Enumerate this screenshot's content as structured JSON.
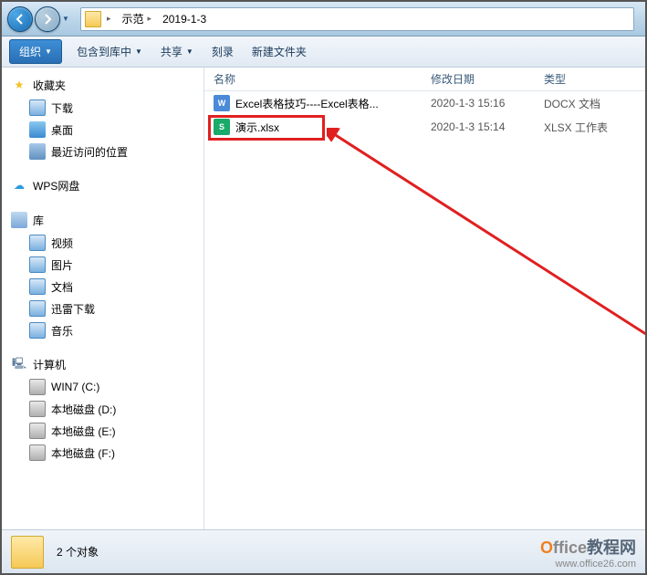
{
  "breadcrumb": {
    "seg1": "示范",
    "seg2": "2019-1-3"
  },
  "toolbar": {
    "organize": "组织",
    "include": "包含到库中",
    "share": "共享",
    "burn": "刻录",
    "newfolder": "新建文件夹"
  },
  "sidebar": {
    "favorites": "收藏夹",
    "downloads": "下载",
    "desktop": "桌面",
    "recent": "最近访问的位置",
    "wps": "WPS网盘",
    "libraries": "库",
    "videos": "视频",
    "pictures": "图片",
    "documents": "文档",
    "xunlei": "迅雷下载",
    "music": "音乐",
    "computer": "计算机",
    "drive_c": "WIN7 (C:)",
    "drive_d": "本地磁盘 (D:)",
    "drive_e": "本地磁盘 (E:)",
    "drive_f": "本地磁盘 (F:)"
  },
  "columns": {
    "name": "名称",
    "date": "修改日期",
    "type": "类型"
  },
  "files": [
    {
      "name": "Excel表格技巧----Excel表格...",
      "date": "2020-1-3 15:16",
      "type": "DOCX 文档",
      "ext": "docx",
      "iconletter": "W"
    },
    {
      "name": "演示.xlsx",
      "date": "2020-1-3 15:14",
      "type": "XLSX 工作表",
      "ext": "xlsx",
      "iconletter": "S"
    }
  ],
  "status": {
    "count": "2 个对象"
  },
  "watermark": {
    "brand1": "O",
    "brand2": "ffice",
    "brand3": "教程网",
    "url": "www.office26.com"
  }
}
